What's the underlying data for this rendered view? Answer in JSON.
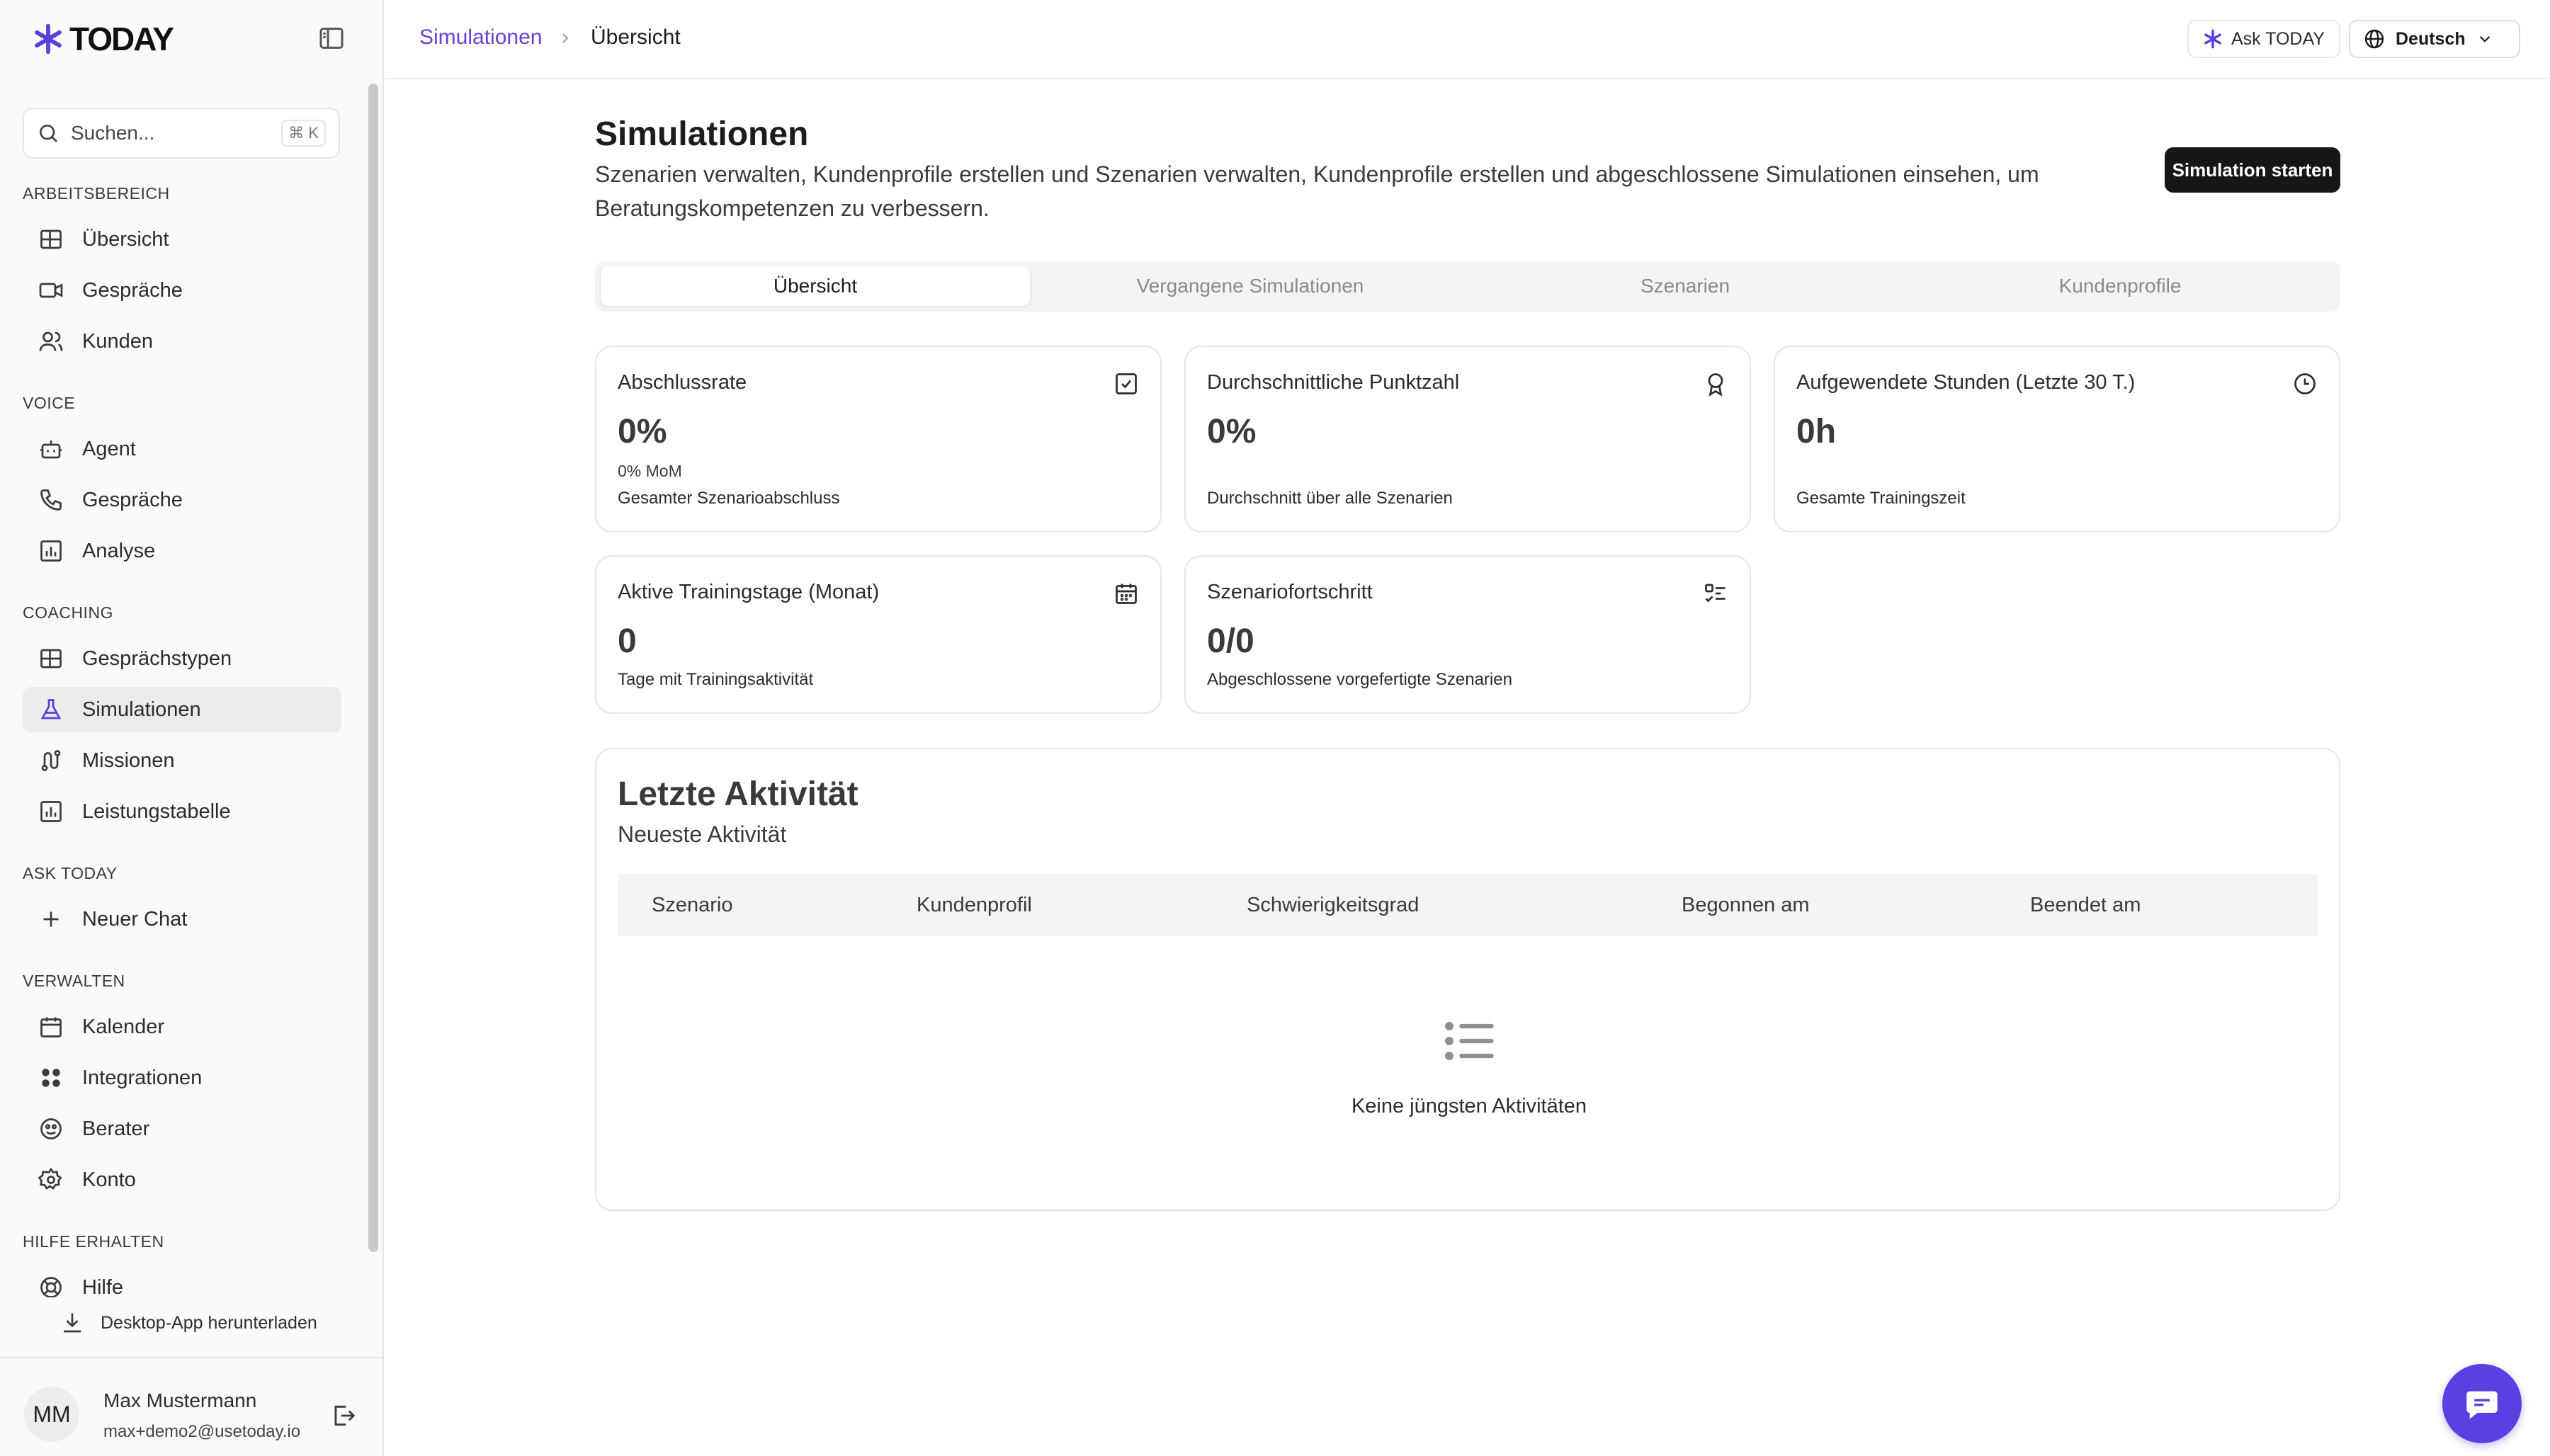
{
  "brand": {
    "name": "TODAY",
    "accent": "#5b3fe0"
  },
  "sidebar": {
    "search": {
      "placeholder": "Suchen...",
      "shortcut": "⌘ K"
    },
    "sections": {
      "workspace": "ARBEITSBEREICH",
      "voice": "VOICE",
      "coaching": "COACHING",
      "ask": "ASK TODAY",
      "manage": "VERWALTEN",
      "help": "HILFE ERHALTEN"
    },
    "items": {
      "overview": "Übersicht",
      "conversations": "Gespräche",
      "customers": "Kunden",
      "agent": "Agent",
      "calls": "Gespräche",
      "analysis": "Analyse",
      "conversation_types": "Gesprächstypen",
      "simulations": "Simulationen",
      "missions": "Missionen",
      "leaderboard": "Leistungstabelle",
      "new_chat": "Neuer Chat",
      "calendar": "Kalender",
      "integrations": "Integrationen",
      "advisors": "Berater",
      "account": "Konto",
      "help": "Hilfe"
    },
    "download": "Desktop-App herunterladen",
    "user": {
      "initials": "MM",
      "name": "Max Mustermann",
      "email": "max+demo2@usetoday.io"
    }
  },
  "topbar": {
    "breadcrumb": [
      "Simulationen",
      "Übersicht"
    ],
    "ask_button": "Ask TODAY",
    "language": "Deutsch"
  },
  "main": {
    "title": "Simulationen",
    "description": "Szenarien verwalten, Kundenprofile erstellen und Szenarien verwalten, Kundenprofile erstellen und abgeschlossene Simulationen einsehen, um Beratungskompetenzen zu verbessern.",
    "start_button": "Simulation starten",
    "tabs": [
      "Übersicht",
      "Vergangene Simulationen",
      "Szenarien",
      "Kundenprofile"
    ],
    "cards": [
      {
        "title": "Abschlussrate",
        "value": "0%",
        "meta": "0% MoM",
        "subtitle": "Gesamter Szenarioabschluss",
        "icon": "check-square-icon"
      },
      {
        "title": "Durchschnittliche Punktzahl",
        "value": "0%",
        "subtitle": "Durchschnitt über alle Szenarien",
        "icon": "award-icon"
      },
      {
        "title": "Aufgewendete Stunden (Letzte 30 T.)",
        "value": "0h",
        "subtitle": "Gesamte Trainingszeit",
        "icon": "clock-icon"
      },
      {
        "title": "Aktive Trainingstage (Monat)",
        "value": "0",
        "subtitle": "Tage mit Trainingsaktivität",
        "icon": "calendar-icon"
      },
      {
        "title": "Szenariofortschritt",
        "value": "0/0",
        "subtitle": "Abgeschlossene vorgefertigte Szenarien",
        "icon": "checklist-icon"
      }
    ],
    "activity": {
      "title": "Letzte Aktivität",
      "subtitle": "Neueste Aktivität",
      "columns": [
        "Szenario",
        "Kundenprofil",
        "Schwierigkeitsgrad",
        "Begonnen am",
        "Beendet am"
      ],
      "empty": "Keine jüngsten Aktivitäten"
    }
  }
}
